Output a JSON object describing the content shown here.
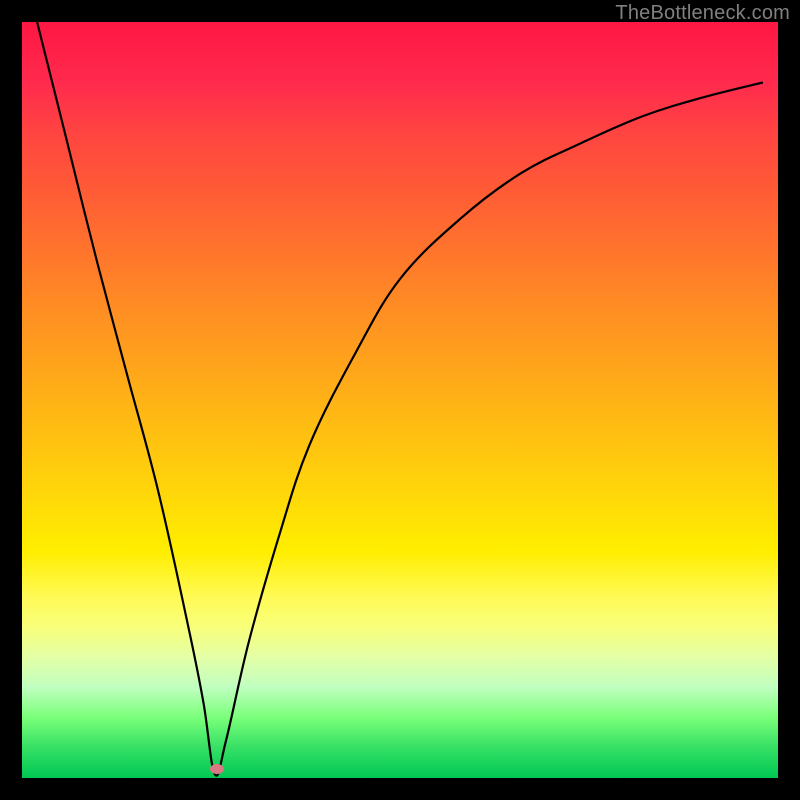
{
  "watermark": "TheBottleneck.com",
  "marker": {
    "x_pct": 25.8,
    "y_pct": 98.8
  },
  "chart_data": {
    "type": "line",
    "title": "",
    "xlabel": "",
    "ylabel": "",
    "xlim": [
      0,
      100
    ],
    "ylim": [
      0,
      100
    ],
    "series": [
      {
        "name": "bottleneck-curve",
        "x": [
          2,
          6,
          10,
          14,
          18,
          22,
          24,
          25.5,
          27,
          30,
          34,
          38,
          44,
          50,
          58,
          66,
          74,
          82,
          90,
          98
        ],
        "values": [
          100,
          84,
          68,
          53,
          38,
          20,
          10,
          0.5,
          5,
          18,
          32,
          44,
          56,
          66,
          74,
          80,
          84,
          87.5,
          90,
          92
        ]
      }
    ],
    "annotations": [
      {
        "type": "marker",
        "x": 25.8,
        "y": 1.0,
        "label": "optimal-point"
      }
    ],
    "background": {
      "type": "vertical-gradient",
      "stops": [
        {
          "pos": 0,
          "color": "#ff1744"
        },
        {
          "pos": 50,
          "color": "#ffb814"
        },
        {
          "pos": 75,
          "color": "#ffee00"
        },
        {
          "pos": 100,
          "color": "#00c853"
        }
      ]
    }
  }
}
